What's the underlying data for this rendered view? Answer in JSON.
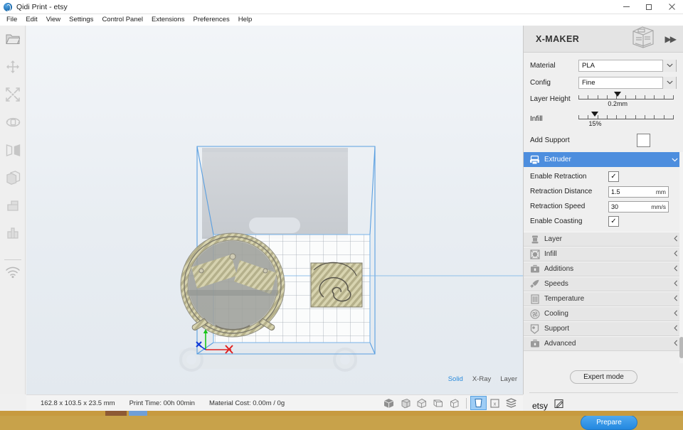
{
  "window": {
    "title": "Qidi Print - etsy",
    "minimize": "—",
    "maximize": "□",
    "close": "✕"
  },
  "menubar": {
    "items": [
      {
        "label": "File"
      },
      {
        "label": "Edit"
      },
      {
        "label": "View"
      },
      {
        "label": "Settings"
      },
      {
        "label": "Control Panel"
      },
      {
        "label": "Extensions"
      },
      {
        "label": "Preferences"
      },
      {
        "label": "Help"
      }
    ]
  },
  "left_toolbar": {
    "items": [
      {
        "name": "open-file-icon",
        "label": "Open File"
      },
      {
        "name": "move-icon",
        "label": "Move"
      },
      {
        "name": "scale-icon",
        "label": "Scale"
      },
      {
        "name": "rotate-icon",
        "label": "Rotate"
      },
      {
        "name": "mirror-icon",
        "label": "Mirror"
      },
      {
        "name": "duplicate-icon",
        "label": "Duplicate"
      },
      {
        "name": "support-blocker-icon",
        "label": "Support Blocker"
      },
      {
        "name": "per-model-settings-icon",
        "label": "Per Model Settings"
      },
      {
        "name": "wifi-icon",
        "label": "Network"
      }
    ]
  },
  "viewport": {
    "view_modes": [
      {
        "label": "Solid",
        "active": true
      },
      {
        "label": "X-Ray",
        "active": false
      },
      {
        "label": "Layer",
        "active": false
      }
    ],
    "axis": {
      "x": "X",
      "y": "Y",
      "z": "Z"
    }
  },
  "statusbar": {
    "dimensions": "162.8 x 103.5 x 23.5 mm",
    "print_time": "Print Time: 00h 00min",
    "material_cost": "Material Cost: 0.00m / 0g",
    "view_buttons": [
      {
        "name": "view-3d-icon",
        "selected": false
      },
      {
        "name": "view-front-icon",
        "selected": false
      },
      {
        "name": "view-top-icon",
        "selected": false
      },
      {
        "name": "view-left-icon",
        "selected": false
      },
      {
        "name": "view-right-icon",
        "selected": false
      }
    ],
    "mode_buttons": [
      {
        "name": "solid-view-icon",
        "selected": true
      },
      {
        "name": "xray-view-icon",
        "selected": false
      },
      {
        "name": "layer-view-icon",
        "selected": false
      }
    ]
  },
  "right_panel": {
    "printer_name": "X-MAKER",
    "printer_icon": "printer-icon",
    "collapse_icon": "▶▶",
    "basic": {
      "material": {
        "label": "Material",
        "value": "PLA"
      },
      "config": {
        "label": "Config",
        "value": "Fine"
      },
      "layer_height": {
        "label": "Layer Height",
        "value": "0.2mm",
        "position_pct": 40
      },
      "infill": {
        "label": "Infill",
        "value": "15%",
        "position_pct": 17
      },
      "add_support": {
        "label": "Add Support",
        "checked": false
      }
    },
    "sections": [
      {
        "label": "Extruder",
        "icon": "extruder-icon",
        "expanded": true,
        "fields": [
          {
            "label": "Enable Retraction",
            "type": "checkbox",
            "checked": true,
            "mark": "✓"
          },
          {
            "label": "Retraction Distance",
            "type": "text",
            "value": "1.5",
            "unit": "mm"
          },
          {
            "label": "Retraction Speed",
            "type": "text",
            "value": "30",
            "unit": "mm/s"
          },
          {
            "label": "Enable Coasting",
            "type": "checkbox",
            "checked": true,
            "mark": "✓"
          }
        ]
      },
      {
        "label": "Layer",
        "icon": "layer-icon",
        "expanded": false
      },
      {
        "label": "Infill",
        "icon": "infill-icon",
        "expanded": false
      },
      {
        "label": "Additions",
        "icon": "additions-icon",
        "expanded": false
      },
      {
        "label": "Speeds",
        "icon": "speeds-icon",
        "expanded": false
      },
      {
        "label": "Temperature",
        "icon": "temperature-icon",
        "expanded": false
      },
      {
        "label": "Cooling",
        "icon": "cooling-icon",
        "expanded": false
      },
      {
        "label": "Support",
        "icon": "support-icon",
        "expanded": false
      },
      {
        "label": "Advanced",
        "icon": "advanced-icon",
        "expanded": false
      }
    ],
    "expert_mode": "Expert mode",
    "project_name": "etsy",
    "edit_icon": "edit-icon",
    "prepare": "Prepare"
  }
}
